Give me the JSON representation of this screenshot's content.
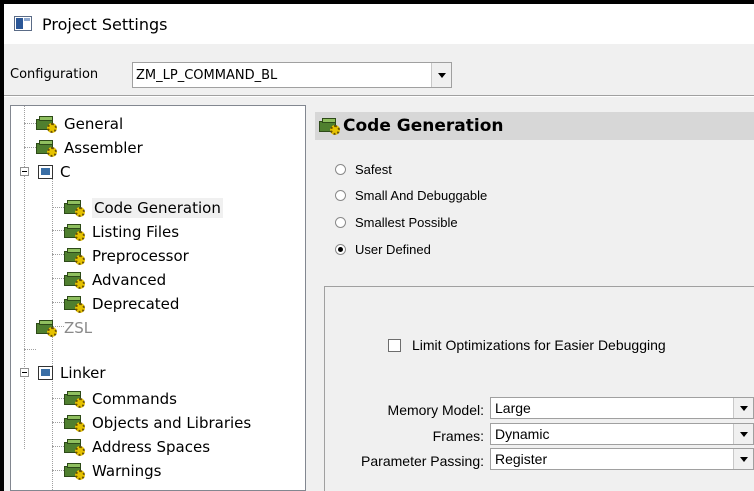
{
  "window": {
    "title": "Project Settings"
  },
  "configuration": {
    "label": "Configuration",
    "value": "ZM_LP_COMMAND_BL"
  },
  "tree": {
    "items": [
      {
        "label": "General",
        "icon": "gear-icon",
        "disabled": false
      },
      {
        "label": "Assembler",
        "icon": "gear-icon",
        "disabled": false
      },
      {
        "label": "C",
        "icon": "folder-icon",
        "disabled": false
      },
      {
        "label": "Code Generation",
        "icon": "gear-icon",
        "selected": true
      },
      {
        "label": "Listing Files",
        "icon": "gear-icon"
      },
      {
        "label": "Preprocessor",
        "icon": "gear-icon"
      },
      {
        "label": "Advanced",
        "icon": "gear-icon"
      },
      {
        "label": "Deprecated",
        "icon": "gear-icon"
      },
      {
        "label": "ZSL",
        "icon": "gear-icon",
        "disabled": true
      },
      {
        "label": "Linker",
        "icon": "folder-icon"
      },
      {
        "label": "Commands",
        "icon": "gear-icon"
      },
      {
        "label": "Objects and Libraries",
        "icon": "gear-icon"
      },
      {
        "label": "Address Spaces",
        "icon": "gear-icon"
      },
      {
        "label": "Warnings",
        "icon": "gear-icon"
      }
    ]
  },
  "panel": {
    "title": "Code Generation",
    "options": [
      {
        "label": "Safest",
        "checked": false
      },
      {
        "label": "Small And Debuggable",
        "checked": false
      },
      {
        "label": "Smallest Possible",
        "checked": false
      },
      {
        "label": "User Defined",
        "checked": true
      }
    ],
    "limit_optimizations": {
      "label": "Limit Optimizations for Easier Debugging",
      "checked": false
    },
    "fields": [
      {
        "label": "Memory Model:",
        "value": "Large"
      },
      {
        "label": "Frames:",
        "value": "Dynamic"
      },
      {
        "label": "Parameter Passing:",
        "value": "Register"
      }
    ]
  }
}
